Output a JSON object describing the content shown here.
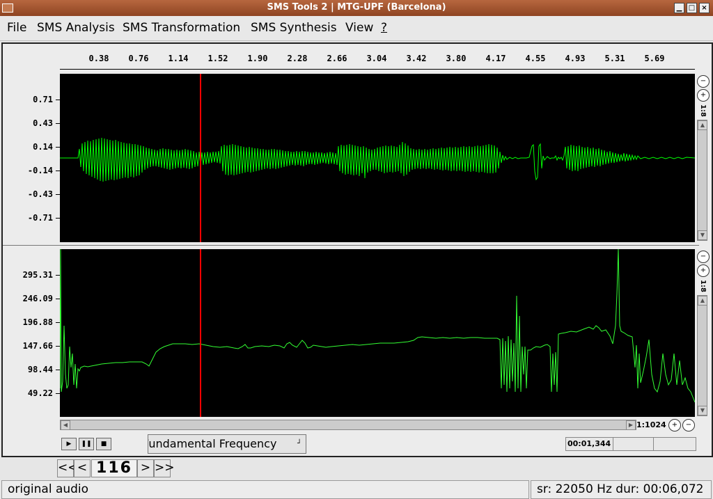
{
  "window": {
    "title": "SMS Tools 2 | MTG-UPF (Barcelona)",
    "min_glyph": "▁",
    "max_glyph": "□",
    "close_glyph": "×"
  },
  "menu": [
    {
      "label": "File"
    },
    {
      "label": "SMS Analysis"
    },
    {
      "label": "SMS Transformation"
    },
    {
      "label": "SMS Synthesis"
    },
    {
      "label": "View"
    },
    {
      "label": "?"
    }
  ],
  "time_axis": {
    "ticks": [
      "0.38",
      "0.76",
      "1.14",
      "1.52",
      "1.90",
      "2.28",
      "2.66",
      "3.04",
      "3.42",
      "3.80",
      "4.17",
      "4.55",
      "4.93",
      "5.31",
      "5.69"
    ]
  },
  "waveform": {
    "y_ticks": [
      "0.71",
      "0.43",
      "0.14",
      "-0.14",
      "-0.43",
      "-0.71"
    ],
    "zoom_ratio": "1:8",
    "color": "#00ff00"
  },
  "pitch": {
    "y_ticks": [
      "295.31",
      "246.09",
      "196.88",
      "147.66",
      "98.44",
      "49.22"
    ],
    "zoom_ratio": "1:8",
    "color": "#33ff33"
  },
  "cursor": {
    "time_text": "00:01,344",
    "color": "#ff0000"
  },
  "hzoom": {
    "ratio": "1:1024"
  },
  "transport": {
    "play": "▶",
    "pause": "❚❚",
    "stop": "■"
  },
  "view_select": {
    "value": "Fundamental Frequency"
  },
  "frame_nav": {
    "first": "<<",
    "prev": "<",
    "value": "116",
    "next": ">",
    "last": ">>"
  },
  "status": {
    "left": "original audio",
    "right": "sr: 22050 Hz  dur: 00:06,072"
  }
}
